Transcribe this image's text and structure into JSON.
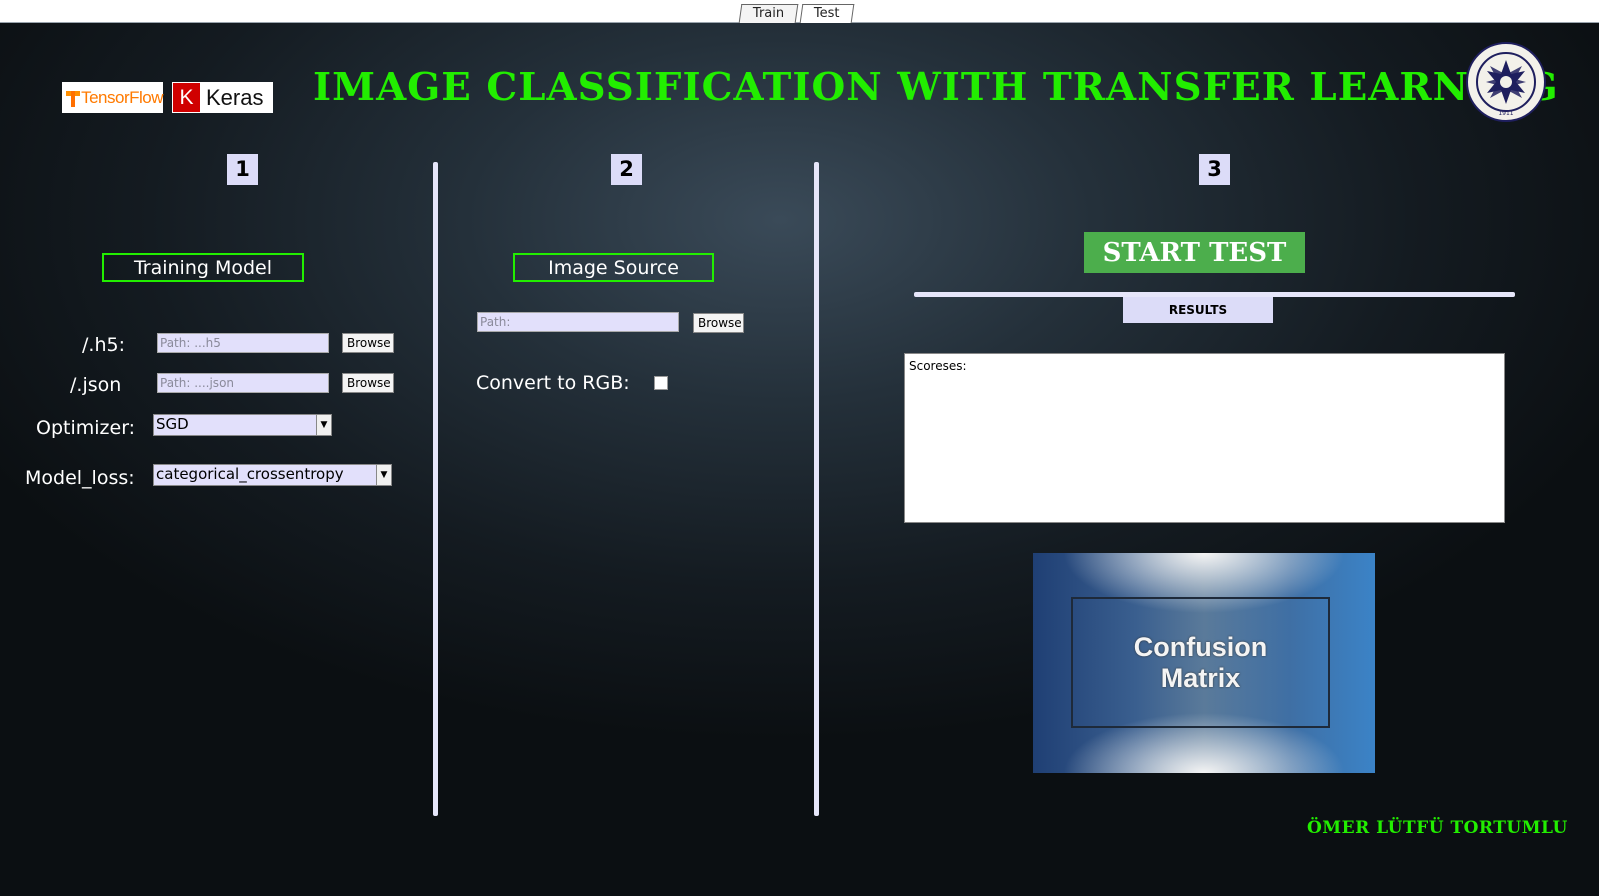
{
  "tabs": [
    {
      "label": "Train"
    },
    {
      "label": "Test"
    }
  ],
  "logos": {
    "tensorflow": "TensorFlow",
    "keras_k": "K",
    "keras": "Keras"
  },
  "title": "IMAGE CLASSIFICATION WITH TRANSFER LEARNING",
  "seal_year": "1911",
  "sections": [
    {
      "number": "1",
      "label": "Training Model"
    },
    {
      "number": "2",
      "label": "Image Source"
    },
    {
      "number": "3"
    }
  ],
  "training": {
    "h5_label": "/.h5:",
    "h5_placeholder": "Path: ...h5",
    "json_label": "/.json",
    "json_placeholder": "Path: ....json",
    "browse": "Browse",
    "optimizer_label": "Optimizer:",
    "optimizer_value": "SGD",
    "loss_label": "Model_loss:",
    "loss_value": "categorical_crossentropy"
  },
  "image_source": {
    "path_placeholder": "Path:",
    "browse": "Browse",
    "rgb_label": "Convert to RGB:",
    "rgb_checked": false
  },
  "test": {
    "start_label": "START TEST",
    "results_label": "RESULTS",
    "scores_text": "Scoreses:",
    "confusion_line1": "Confusion",
    "confusion_line2": "Matrix"
  },
  "author": "ÖMER LÜTFÜ TORTUMLU",
  "colors": {
    "accent_green": "#22ee00",
    "button_green": "#4cae4c",
    "panel_lavender": "#dcdcf8"
  }
}
